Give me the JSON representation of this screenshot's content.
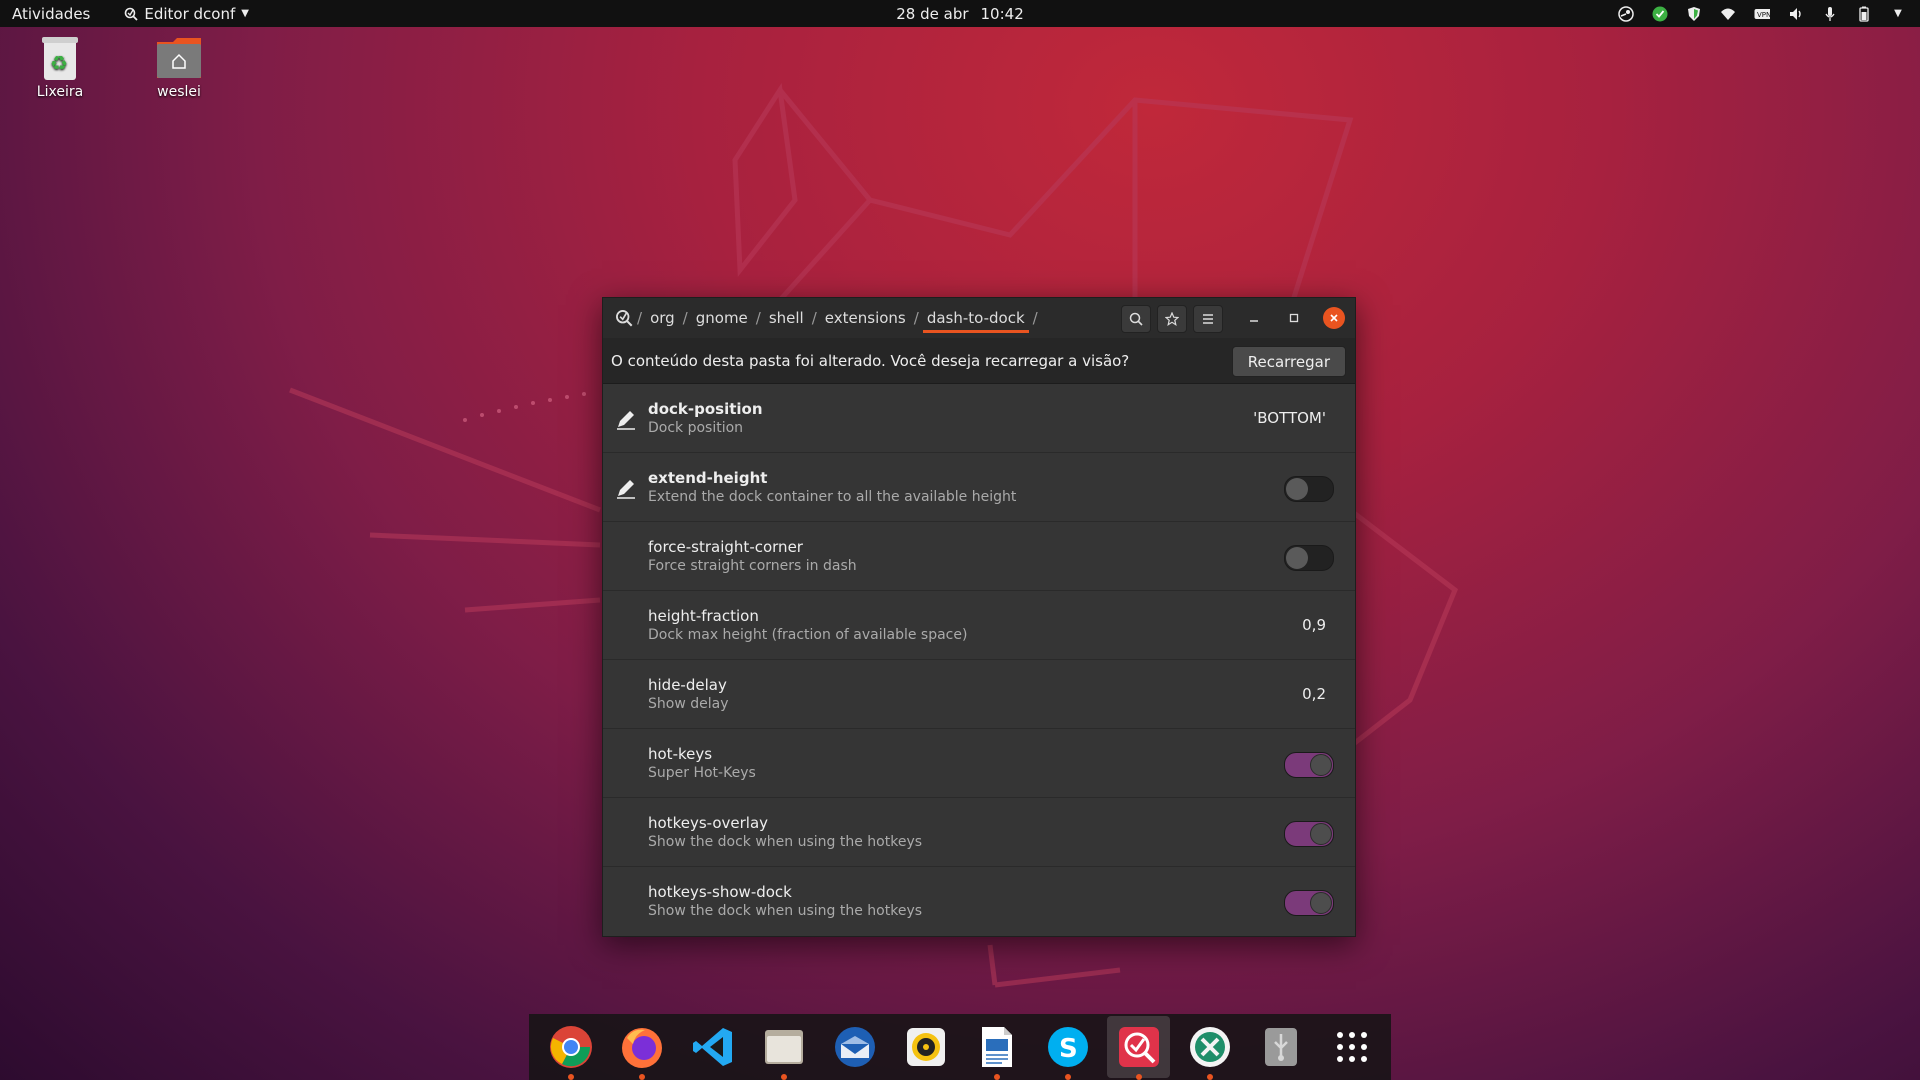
{
  "topbar": {
    "activities": "Atividades",
    "app_menu": "Editor dconf",
    "date": "28 de abr",
    "time": "10:42",
    "tray_icons": [
      "steam-icon",
      "checkmark-shield-icon",
      "shield-icon",
      "wifi-icon",
      "vpn-icon",
      "volume-icon",
      "microphone-icon",
      "battery-icon",
      "chevron-down-icon"
    ]
  },
  "desktop": {
    "icons": [
      {
        "label": "Lixeira",
        "icon": "trash-icon"
      },
      {
        "label": "weslei",
        "icon": "home-folder-icon"
      }
    ]
  },
  "window": {
    "breadcrumb": [
      "org",
      "gnome",
      "shell",
      "extensions",
      "dash-to-dock"
    ],
    "breadcrumb_sep": "/",
    "infobar": {
      "message": "O conteúdo desta pasta foi alterado. Você deseja recarregar a visão?",
      "button": "Recarregar"
    },
    "rows": [
      {
        "key": "dock-position",
        "desc": "Dock position",
        "value": "'BOTTOM'",
        "modified": true
      },
      {
        "key": "extend-height",
        "desc": "Extend the dock container to all the available height",
        "toggle": false,
        "modified": true
      },
      {
        "key": "force-straight-corner",
        "desc": "Force straight corners in dash",
        "toggle": false,
        "modified": false
      },
      {
        "key": "height-fraction",
        "desc": "Dock max height (fraction of available space)",
        "value": "0,9",
        "modified": false
      },
      {
        "key": "hide-delay",
        "desc": "Show delay",
        "value": "0,2",
        "modified": false
      },
      {
        "key": "hot-keys",
        "desc": "Super Hot-Keys",
        "toggle": true,
        "modified": false
      },
      {
        "key": "hotkeys-overlay",
        "desc": "Show the dock when using the hotkeys",
        "toggle": true,
        "modified": false
      },
      {
        "key": "hotkeys-show-dock",
        "desc": "Show the dock when using the hotkeys",
        "toggle": true,
        "modified": false
      }
    ]
  },
  "dock": {
    "apps": [
      "chrome",
      "firefox",
      "vscode",
      "files",
      "thunderbird",
      "rhythmbox",
      "libreoffice-writer",
      "skype",
      "dconf-editor",
      "remmina",
      "usb-creator",
      "show-applications"
    ]
  },
  "colors": {
    "accent": "#e95420",
    "toggle_on": "#7b3a7a"
  }
}
